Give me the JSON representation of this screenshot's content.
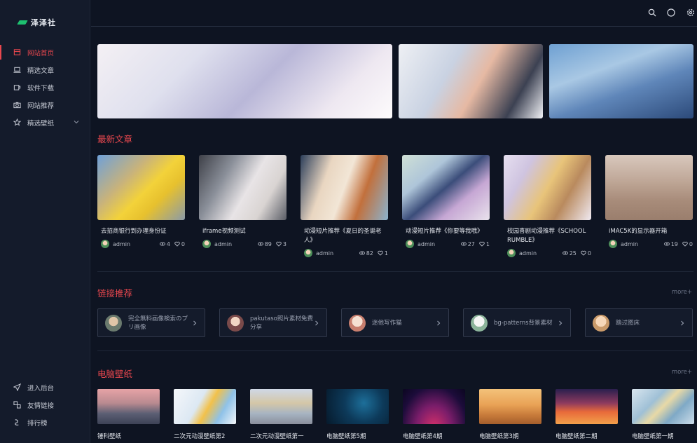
{
  "brand": {
    "name": "泽泽社",
    "accent": "#e8474e",
    "logo_color": "#1ec070"
  },
  "sidebar": {
    "items": [
      {
        "label": "网站首页",
        "icon": "home-icon",
        "active": true
      },
      {
        "label": "精选文章",
        "icon": "laptop-icon",
        "active": false
      },
      {
        "label": "软件下载",
        "icon": "cup-icon",
        "active": false
      },
      {
        "label": "网站推荐",
        "icon": "camera-icon",
        "active": false
      },
      {
        "label": "精选壁纸",
        "icon": "star-icon",
        "active": false,
        "has_submenu": true
      }
    ],
    "bottom_items": [
      {
        "label": "进入后台",
        "icon": "send-icon"
      },
      {
        "label": "友情链接",
        "icon": "link-icon"
      },
      {
        "label": "排行榜",
        "icon": "rank-icon"
      }
    ]
  },
  "topbar": {
    "icons": [
      "search-icon",
      "moon-icon",
      "gear-icon"
    ]
  },
  "sections": {
    "latest": {
      "title": "最新文章"
    },
    "links": {
      "title": "链接推荐",
      "more": "more+"
    },
    "wallpapers": {
      "title": "电脑壁纸",
      "more": "more+"
    }
  },
  "articles": [
    {
      "title": "去招商银行到办理身份证",
      "author": "admin",
      "views": "4",
      "likes": "0"
    },
    {
      "title": "iframe视频测试",
      "author": "admin",
      "views": "89",
      "likes": "3"
    },
    {
      "title": "动漫短片推荐《夏日的圣诞老人》",
      "author": "admin",
      "views": "82",
      "likes": "1"
    },
    {
      "title": "动漫短片推荐《你要等我哦》",
      "author": "admin",
      "views": "27",
      "likes": "1"
    },
    {
      "title": "校园喜剧动漫推荐《SCHOOL RUMBLE》",
      "author": "admin",
      "views": "25",
      "likes": "0"
    },
    {
      "title": "iMAC5K的显示器开箱",
      "author": "admin",
      "views": "19",
      "likes": "0"
    }
  ],
  "links": [
    {
      "title": "完全無料画像検索のプリ画像"
    },
    {
      "title": "pakutaso照片素材免费分享"
    },
    {
      "title": "迷他写作猫"
    },
    {
      "title": "bg-patterns背景素材"
    },
    {
      "title": "踏过图床"
    }
  ],
  "wallpapers": [
    {
      "title": "锤科壁纸"
    },
    {
      "title": "二次元动漫壁纸第2"
    },
    {
      "title": "二次元动漫壁纸第一"
    },
    {
      "title": "电脑壁纸第5期"
    },
    {
      "title": "电脑壁纸第4期"
    },
    {
      "title": "电脑壁纸第3期"
    },
    {
      "title": "电脑壁纸第二期"
    },
    {
      "title": "电脑壁纸第一期"
    }
  ]
}
